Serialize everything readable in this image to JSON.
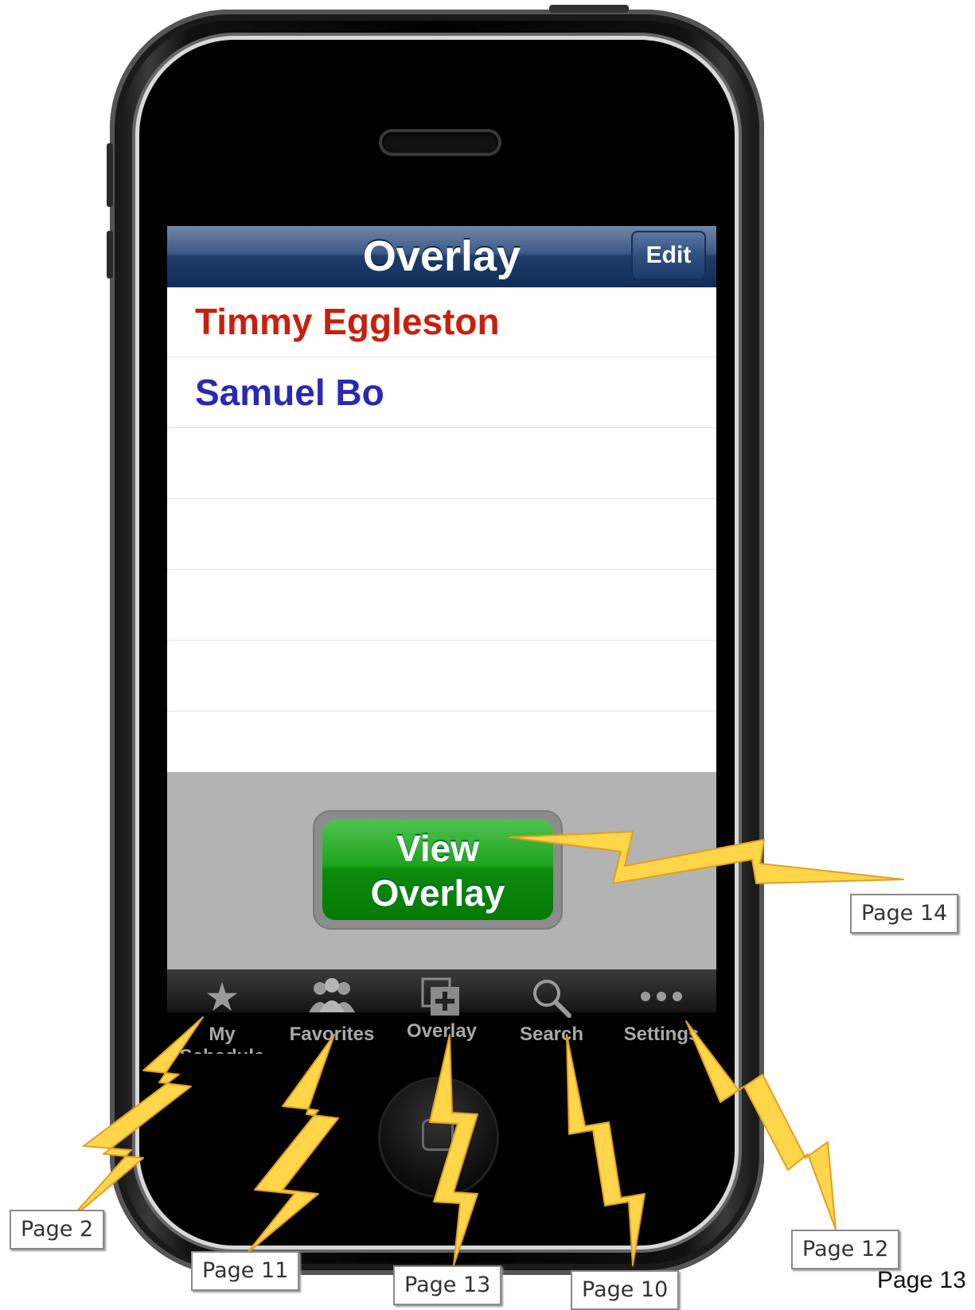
{
  "nav": {
    "title": "Overlay",
    "edit_label": "Edit"
  },
  "list": {
    "rows": [
      {
        "label": "Timmy Eggleston",
        "color": "#c8200c"
      },
      {
        "label": "Samuel Bo",
        "color": "#2929b5"
      },
      {
        "label": ""
      },
      {
        "label": ""
      },
      {
        "label": ""
      },
      {
        "label": ""
      },
      {
        "label": ""
      }
    ]
  },
  "overlay_button": {
    "line1": "View",
    "line2": "Overlay"
  },
  "tabs": [
    {
      "label": "My Schedule",
      "icon": "star-icon",
      "selected": false
    },
    {
      "label": "Favorites",
      "icon": "people-icon",
      "selected": false
    },
    {
      "label": "Overlay",
      "icon": "overlay-plus-icon",
      "selected": true
    },
    {
      "label": "Search",
      "icon": "magnifier-icon",
      "selected": false
    },
    {
      "label": "Settings",
      "icon": "more-dots-icon",
      "selected": false
    }
  ],
  "annotations": {
    "view_overlay": "Page 14",
    "my_schedule": "Page 2",
    "favorites": "Page 11",
    "overlay": "Page 13",
    "search": "Page 10",
    "settings": "Page 12"
  },
  "footer": {
    "page_number": "Page 13"
  },
  "colors": {
    "nav_bar": "#1f3d6b",
    "button_green": "#0b8a0b",
    "overlay_gray": "#b3b3b3",
    "bolt_yellow": "#ffd54a"
  }
}
